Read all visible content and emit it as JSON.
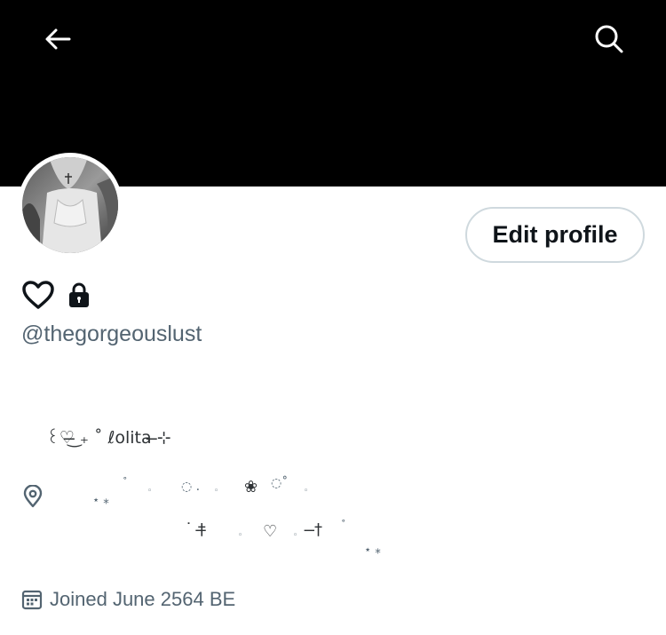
{
  "header": {
    "back_icon": "arrow-left-icon",
    "search_icon": "search-icon",
    "banner_color": "#000000"
  },
  "profile": {
    "edit_button_label": "Edit profile",
    "name_icons": [
      "heart-icon",
      "lock-icon"
    ],
    "handle": "@thegorgeouslust",
    "bio_line": "꒰♡̶͜ ₊ ˚ ℓolita ̶⊹",
    "location_icon": "map-pin-icon",
    "location_fragments": [
      "⋆ ⁎",
      "˚",
      "◦",
      "◌ .",
      "◦",
      "❀",
      "◌˚",
      "◦",
      "˙ †̶",
      "◦",
      "♡",
      "◦",
      "̶†",
      "˚",
      "⋆ ⁎"
    ],
    "joined_icon": "calendar-icon",
    "joined_text": "Joined June 2564 BE"
  },
  "colors": {
    "text_primary": "#0f1419",
    "text_secondary": "#536471",
    "border": "#cfd9de"
  }
}
